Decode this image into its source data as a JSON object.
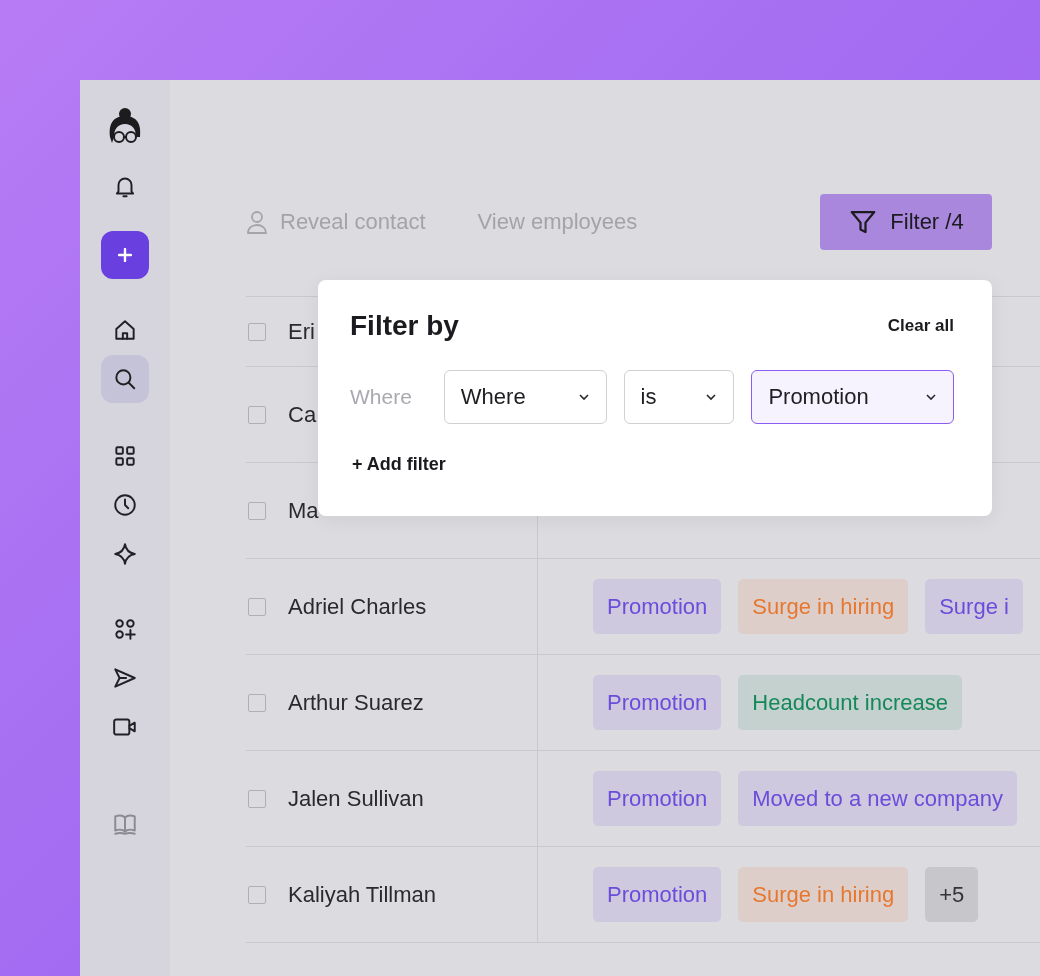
{
  "sidebar": {
    "items": [
      {
        "kind": "avatar",
        "selected": false
      },
      {
        "kind": "bell",
        "selected": false
      },
      {
        "kind": "add",
        "selected": false
      },
      {
        "kind": "home",
        "selected": false
      },
      {
        "kind": "search",
        "selected": true
      },
      {
        "kind": "grid",
        "selected": false
      },
      {
        "kind": "clock",
        "selected": false
      },
      {
        "kind": "sparkle",
        "selected": false
      },
      {
        "kind": "apps-add",
        "selected": false
      },
      {
        "kind": "send",
        "selected": false
      },
      {
        "kind": "video",
        "selected": false
      },
      {
        "kind": "book",
        "selected": false
      }
    ]
  },
  "toolbar": {
    "reveal_contact": "Reveal contact",
    "view_employees": "View employees",
    "filter_button": "Filter /4"
  },
  "table": {
    "rows": [
      {
        "name": "Eri",
        "checked": false,
        "tags": []
      },
      {
        "name": "Ca",
        "checked": false,
        "tags": []
      },
      {
        "name": "Ma",
        "checked": false,
        "tags": []
      },
      {
        "name": "Adriel Charles",
        "checked": false,
        "tags": [
          {
            "text": "Promotion",
            "color": "#6a4ddb"
          },
          {
            "text": "Surge in hiring",
            "color": "#e8772e"
          },
          {
            "text": "Surge i",
            "color": "#6a4ddb"
          }
        ]
      },
      {
        "name": "Arthur Suarez",
        "checked": false,
        "tags": [
          {
            "text": "Promotion",
            "color": "#6a4ddb"
          },
          {
            "text": "Headcount increase",
            "color": "#15885a"
          }
        ]
      },
      {
        "name": "Jalen Sullivan",
        "checked": false,
        "tags": [
          {
            "text": "Promotion",
            "color": "#6a4ddb"
          },
          {
            "text": "Moved to a new company",
            "color": "#6a4ddb"
          }
        ]
      },
      {
        "name": "Kaliyah Tillman",
        "checked": false,
        "tags": [
          {
            "text": "Promotion",
            "color": "#6a4ddb"
          },
          {
            "text": "Surge in hiring",
            "color": "#e8772e"
          },
          {
            "text": "+5",
            "color": "#333338"
          }
        ]
      }
    ]
  },
  "filter_popover": {
    "title": "Filter by",
    "clear_all": "Clear all",
    "where_label": "Where",
    "dropdowns": [
      {
        "value": "Where",
        "active": false
      },
      {
        "value": "is",
        "active": false
      },
      {
        "value": "Promotion",
        "active": true
      }
    ],
    "add_filter": "+ Add filter"
  }
}
